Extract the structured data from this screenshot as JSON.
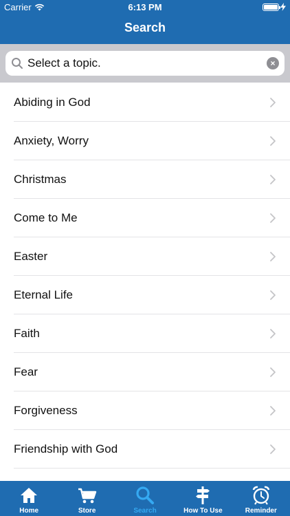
{
  "status": {
    "carrier": "Carrier",
    "time": "6:13 PM"
  },
  "nav": {
    "title": "Search"
  },
  "search": {
    "placeholder": "Select a topic."
  },
  "topics": [
    "Abiding in God",
    "Anxiety, Worry",
    "Christmas",
    "Come to Me",
    "Easter",
    "Eternal Life",
    "Faith",
    "Fear",
    "Forgiveness",
    "Friendship with God"
  ],
  "tabs": [
    {
      "label": "Home",
      "icon": "home-icon",
      "active": false
    },
    {
      "label": "Store",
      "icon": "cart-icon",
      "active": false
    },
    {
      "label": "Search",
      "icon": "search-icon",
      "active": true
    },
    {
      "label": "How To Use",
      "icon": "signpost-icon",
      "active": false
    },
    {
      "label": "Reminder",
      "icon": "alarm-clock-icon",
      "active": false
    }
  ],
  "colors": {
    "bar": "#1f6cb1",
    "active_tab": "#35a9f2",
    "search_bg": "#c9c9ce"
  }
}
